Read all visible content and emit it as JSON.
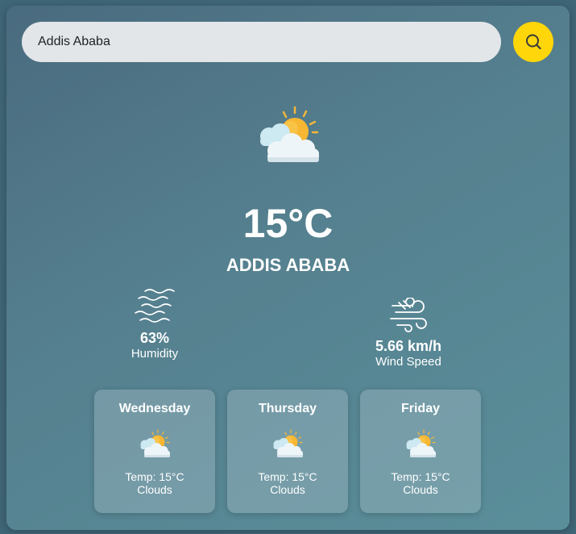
{
  "search": {
    "value": "Addis Ababa",
    "button_icon": "search-icon"
  },
  "current": {
    "icon": "partly-cloudy-icon",
    "temperature": "15°C",
    "city": "ADDIS ABABA",
    "humidity_value": "63%",
    "humidity_label": "Humidity",
    "humidity_icon": "humidity-waves-icon",
    "wind_value": "5.66 km/h",
    "wind_label": "Wind Speed",
    "wind_icon": "wind-icon"
  },
  "forecast": [
    {
      "day": "Wednesday",
      "temp": "Temp: 15°C",
      "desc": "Clouds",
      "icon": "partly-cloudy-icon"
    },
    {
      "day": "Thursday",
      "temp": "Temp: 15°C",
      "desc": "Clouds",
      "icon": "partly-cloudy-icon"
    },
    {
      "day": "Friday",
      "temp": "Temp: 15°C",
      "desc": "Clouds",
      "icon": "partly-cloudy-icon"
    }
  ],
  "colors": {
    "accent": "#ffd60a",
    "card_bg": "#55808f",
    "text": "#ffffff"
  }
}
